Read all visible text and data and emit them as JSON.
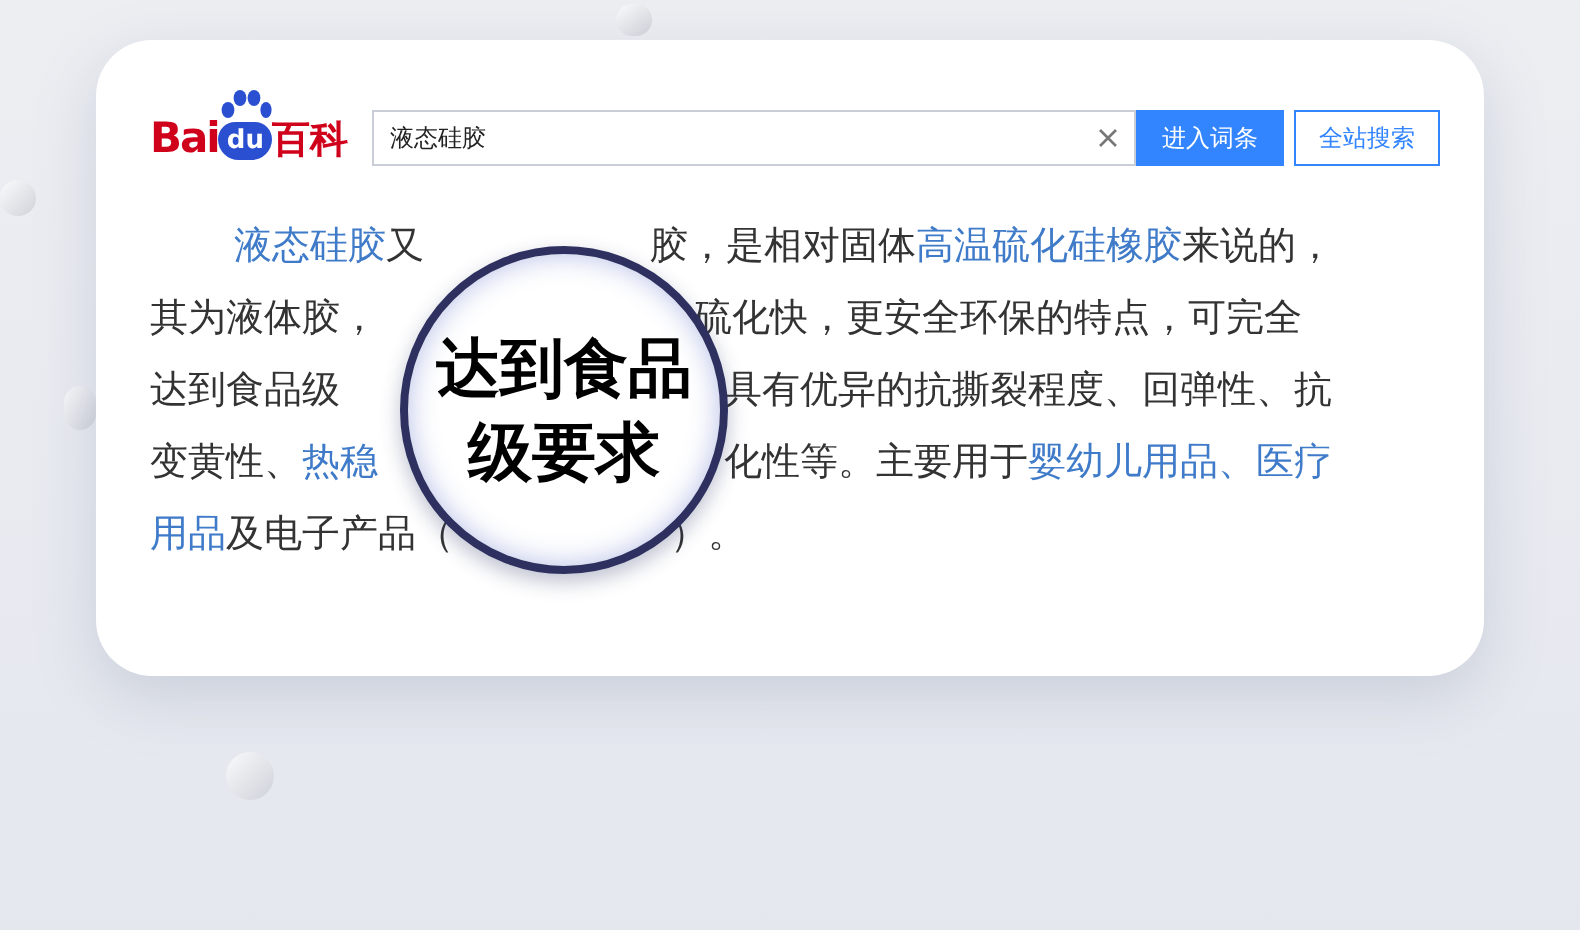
{
  "logo": {
    "text_left": "Bai",
    "text_mark": "du",
    "text_right": "百科"
  },
  "search": {
    "value": "液态硅胶"
  },
  "buttons": [
    {
      "label": "进入词条",
      "kind": "primary"
    },
    {
      "label": "全站搜索",
      "kind": "outline"
    }
  ],
  "paragraph": {
    "lines": [
      [
        [
          {
            "text": "液态硅胶",
            "link": true
          },
          {
            "text": "又",
            "link": false
          }
        ],
        [
          {
            "text": "胶，是相对固体",
            "link": false
          },
          {
            "text": "高温硫化硅橡胶",
            "link": true
          },
          {
            "text": "来说的，",
            "link": false
          }
        ]
      ],
      [
        [
          {
            "text": "其为液体胶，",
            "link": false
          }
        ],
        [
          {
            "text": "硫化快，更安全环保的特点，可完全",
            "link": false
          }
        ]
      ],
      [
        [
          {
            "text": "达到食品级",
            "link": false
          }
        ],
        [
          {
            "text": "具有优异的抗撕裂程度、回弹性、抗",
            "link": false
          }
        ]
      ],
      [
        [
          {
            "text": "变黄性、",
            "link": false
          },
          {
            "text": "热稳",
            "link": true
          }
        ],
        [
          {
            "text": "化性等。主要用于",
            "link": false
          },
          {
            "text": "婴幼儿用品、医疗",
            "link": true
          }
        ]
      ],
      [
        [
          {
            "text": "用品",
            "link": true
          },
          {
            "text": "及电子产品（",
            "link": false
          }
        ],
        [
          {
            "text": "）。",
            "link": false
          }
        ]
      ]
    ]
  },
  "magnifier": {
    "lines": [
      "达到食品",
      "级要求"
    ]
  }
}
